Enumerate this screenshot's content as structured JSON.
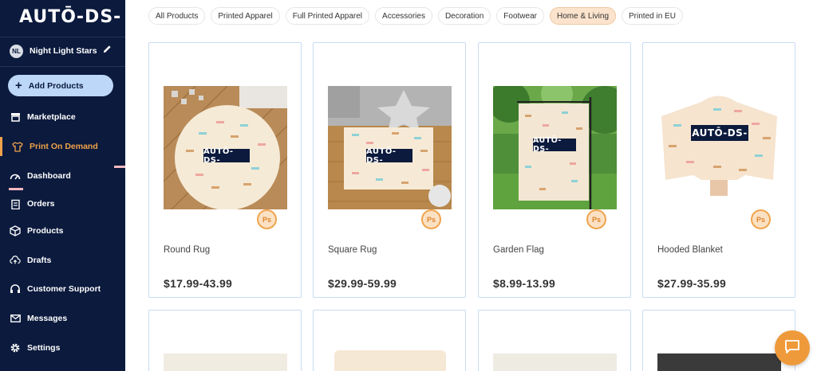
{
  "sidebar": {
    "logo": "AUTŌ-DS-",
    "store": {
      "initials": "NL",
      "name": "Night Light Stars"
    },
    "add_button": "Add Products",
    "nav": [
      {
        "id": "marketplace",
        "label": "Marketplace",
        "icon": "store-icon"
      },
      {
        "id": "print-on-demand",
        "label": "Print On Demand",
        "icon": "shirt-icon",
        "active": true
      },
      {
        "id": "dashboard",
        "label": "Dashboard",
        "icon": "gauge-icon"
      },
      {
        "id": "orders",
        "label": "Orders",
        "icon": "clipboard-icon"
      },
      {
        "id": "products",
        "label": "Products",
        "icon": "box-icon"
      },
      {
        "id": "drafts",
        "label": "Drafts",
        "icon": "cloud-upload-icon"
      },
      {
        "id": "customer-support",
        "label": "Customer Support",
        "icon": "headset-icon"
      },
      {
        "id": "messages",
        "label": "Messages",
        "icon": "mail-icon"
      },
      {
        "id": "settings",
        "label": "Settings",
        "icon": "gear-icon"
      }
    ]
  },
  "filters": [
    {
      "label": "All Products"
    },
    {
      "label": "Printed Apparel"
    },
    {
      "label": "Full Printed Apparel"
    },
    {
      "label": "Accessories"
    },
    {
      "label": "Decoration"
    },
    {
      "label": "Footwear"
    },
    {
      "label": "Home & Living",
      "active": true
    },
    {
      "label": "Printed in EU"
    }
  ],
  "products": [
    {
      "name": "Round Rug",
      "price": "$17.99-43.99",
      "badge": "Ps"
    },
    {
      "name": "Square Rug",
      "price": "$29.99-59.99",
      "badge": "Ps"
    },
    {
      "name": "Garden Flag",
      "price": "$8.99-13.99",
      "badge": "Ps"
    },
    {
      "name": "Hooded Blanket",
      "price": "$27.99-35.99",
      "badge": "Ps"
    }
  ],
  "product_logo": "AUTŌ-DS-",
  "colors": {
    "sidebar": "#0b1a3d",
    "accent": "#f0a24a",
    "add_button": "#bcd7f7",
    "card_border": "#c9dcf4"
  }
}
